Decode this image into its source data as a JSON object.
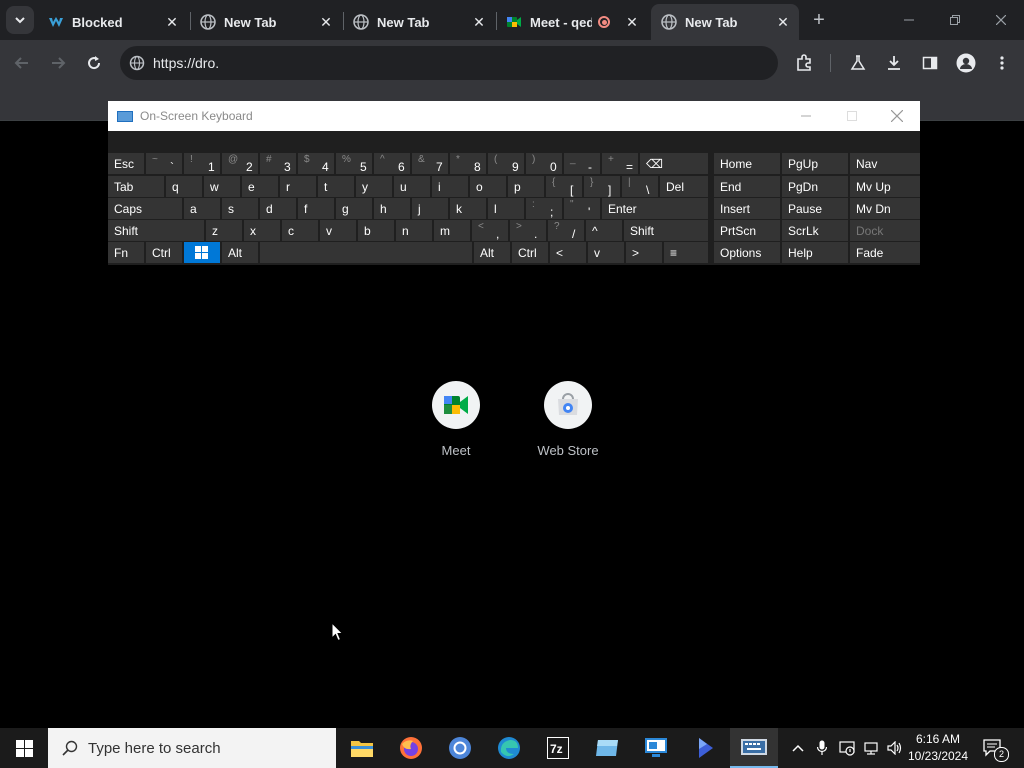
{
  "browser": {
    "tabs": [
      {
        "label": "Blocked",
        "icon": "blocked-tab-icon",
        "active": false
      },
      {
        "label": "New Tab",
        "icon": "globe-icon",
        "active": false
      },
      {
        "label": "New Tab",
        "icon": "globe-icon",
        "active": false
      },
      {
        "label": "Meet - qed",
        "icon": "google-meet-icon",
        "active": false,
        "recording": true
      },
      {
        "label": "New Tab",
        "icon": "globe-icon",
        "active": true
      }
    ],
    "close_glyph": "✕",
    "new_tab_glyph": "+",
    "address": "https://dro."
  },
  "osk": {
    "title": "On-Screen Keyboard",
    "rows": {
      "r1": [
        {
          "label": "Esc"
        },
        {
          "shift": "~",
          "char": "`"
        },
        {
          "shift": "!",
          "char": "1"
        },
        {
          "shift": "@",
          "char": "2"
        },
        {
          "shift": "#",
          "char": "3"
        },
        {
          "shift": "$",
          "char": "4"
        },
        {
          "shift": "%",
          "char": "5"
        },
        {
          "shift": "^",
          "char": "6"
        },
        {
          "shift": "&",
          "char": "7"
        },
        {
          "shift": "*",
          "char": "8"
        },
        {
          "shift": "(",
          "char": "9"
        },
        {
          "shift": ")",
          "char": "0"
        },
        {
          "shift": "_",
          "char": "-"
        },
        {
          "shift": "+",
          "char": "="
        },
        {
          "label": "⌫"
        }
      ],
      "r2": [
        {
          "label": "Tab"
        },
        {
          "label": "q"
        },
        {
          "label": "w"
        },
        {
          "label": "e"
        },
        {
          "label": "r"
        },
        {
          "label": "t"
        },
        {
          "label": "y"
        },
        {
          "label": "u"
        },
        {
          "label": "i"
        },
        {
          "label": "o"
        },
        {
          "label": "p"
        },
        {
          "shift": "{",
          "char": "["
        },
        {
          "shift": "}",
          "char": "]"
        },
        {
          "shift": "|",
          "char": "\\"
        },
        {
          "label": "Del"
        }
      ],
      "r3": [
        {
          "label": "Caps"
        },
        {
          "label": "a"
        },
        {
          "label": "s"
        },
        {
          "label": "d"
        },
        {
          "label": "f"
        },
        {
          "label": "g"
        },
        {
          "label": "h"
        },
        {
          "label": "j"
        },
        {
          "label": "k"
        },
        {
          "label": "l"
        },
        {
          "shift": ":",
          "char": ";"
        },
        {
          "shift": "\"",
          "char": "'"
        },
        {
          "label": "Enter"
        }
      ],
      "r4": [
        {
          "label": "Shift"
        },
        {
          "label": "z"
        },
        {
          "label": "x"
        },
        {
          "label": "c"
        },
        {
          "label": "v"
        },
        {
          "label": "b"
        },
        {
          "label": "n"
        },
        {
          "label": "m"
        },
        {
          "shift": "<",
          "char": ","
        },
        {
          "shift": ">",
          "char": "."
        },
        {
          "shift": "?",
          "char": "/"
        },
        {
          "label": "^"
        },
        {
          "label": "Shift"
        }
      ],
      "r5": [
        {
          "label": "Fn"
        },
        {
          "label": "Ctrl"
        },
        {
          "label": ""
        },
        {
          "label": "Alt"
        },
        {
          "label": ""
        },
        {
          "label": "Alt"
        },
        {
          "label": "Ctrl"
        },
        {
          "label": "<"
        },
        {
          "label": "v"
        },
        {
          "label": ">"
        },
        {
          "label": "≡"
        }
      ]
    },
    "nav_rows": [
      [
        "Home",
        "PgUp",
        "Nav"
      ],
      [
        "End",
        "PgDn",
        "Mv Up"
      ],
      [
        "Insert",
        "Pause",
        "Mv Dn"
      ],
      [
        "PrtScn",
        "ScrLk",
        "Dock"
      ],
      [
        "Options",
        "Help",
        "Fade"
      ]
    ]
  },
  "shortcuts": [
    {
      "label": "Meet",
      "icon": "google-meet-icon"
    },
    {
      "label": "Web Store",
      "icon": "chrome-web-store-icon"
    }
  ],
  "taskbar": {
    "search_placeholder": "Type here to search",
    "apps": [
      "file-explorer-icon",
      "firefox-icon",
      "chrome-icon",
      "edge-icon",
      "7zip-icon",
      "app-icon",
      "remote-desktop-icon",
      "power-automate-icon",
      "on-screen-keyboard-icon"
    ],
    "time": "6:16 AM",
    "date": "10/23/2024",
    "notification_count": "2"
  },
  "colors": {
    "tabstrip": "#202124",
    "toolbar": "#35363a",
    "osk_accent": "#0078d7",
    "key": "#343434"
  }
}
